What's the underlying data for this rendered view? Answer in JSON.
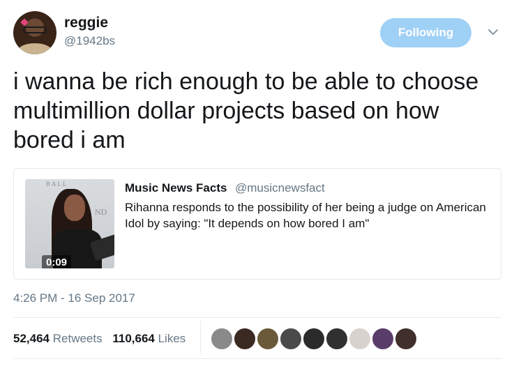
{
  "user": {
    "name": "reggie",
    "handle": "@1942bs",
    "follow_label": "Following"
  },
  "tweet": {
    "text": "i wanna be rich enough to be able to choose multimillion dollar projects based on how bored i am"
  },
  "quoted": {
    "name": "Music News Facts",
    "handle": "@musicnewsfact",
    "text": "Rihanna responds to the possibility of her being a judge on American Idol by saying: \"It depends on how bored I am\"",
    "video_duration": "0:09",
    "thumb_wall_text": "BALL",
    "thumb_wall_text2": "ND"
  },
  "timestamp": "4:26 PM - 16 Sep 2017",
  "stats": {
    "retweets_count": "52,464",
    "retweets_label": "Retweets",
    "likes_count": "110,664",
    "likes_label": "Likes"
  },
  "icons": {
    "caret": "chevron-down-icon"
  },
  "colors": {
    "follow_bg": "#9fd0f6",
    "secondary_text": "#657786",
    "primary_text": "#14171a",
    "border": "#e1e8ed"
  },
  "likers": [
    {
      "color": "#8a8a8a"
    },
    {
      "color": "#3b2a22"
    },
    {
      "color": "#6b5a3a"
    },
    {
      "color": "#4a4a4a"
    },
    {
      "color": "#2b2b2b"
    },
    {
      "color": "#303030"
    },
    {
      "color": "#d8d2cf"
    },
    {
      "color": "#5a3d6a"
    },
    {
      "color": "#402f2a"
    }
  ]
}
